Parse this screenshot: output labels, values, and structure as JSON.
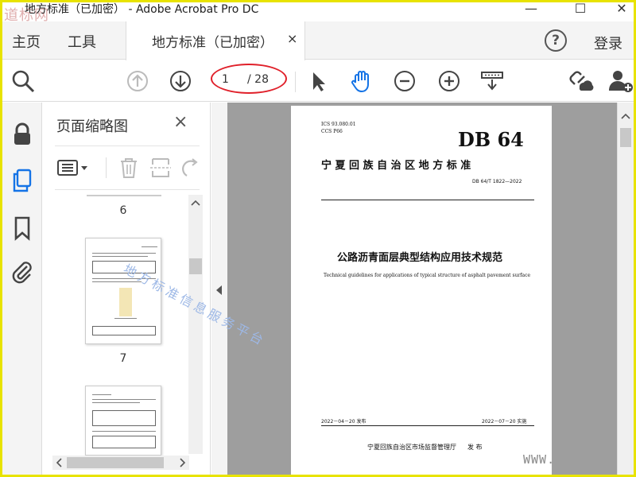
{
  "window": {
    "title": "地方标准（已加密） - Adobe Acrobat Pro DC",
    "watermark_logo": "道标网",
    "minimize": "—",
    "maximize": "☐",
    "close": "✕"
  },
  "menubar": {
    "home": "主页",
    "tools": "工具",
    "tab_label": "地方标准（已加密）",
    "tab_close": "×",
    "help": "?",
    "login": "登录"
  },
  "toolbar": {
    "page_current": "1",
    "page_total": "/ 28",
    "icons": [
      "search-icon",
      "page-up-icon",
      "page-down-icon",
      "select-cursor-icon",
      "hand-icon",
      "zoom-out-icon",
      "zoom-in-icon",
      "scroll-mode-icon",
      "share-link-icon",
      "add-user-icon"
    ]
  },
  "thumbnails_panel": {
    "title": "页面缩略图",
    "close": "×",
    "pages": [
      {
        "label": "6"
      },
      {
        "label": "7"
      }
    ]
  },
  "document_page": {
    "ics": "ICS  93.080.01",
    "ccs": "CCS  P66",
    "db_logo": "DB 64",
    "authority": "宁 夏 回 族 自 治 区 地 方 标 准",
    "number": "DB 64/T  1822—2022",
    "title_cn": "公路沥青面层典型结构应用技术规范",
    "title_en": "Technical guidelines for applications of typical structure of asphalt pavement surface",
    "publish_date": "2022－04－20 发布",
    "implement_date": "2022－07－20 实施",
    "issuer": "宁夏回族自治区市场监督管理厅",
    "issue_word": "发  布",
    "watermark": "地方标准信息服务平台"
  },
  "overlay": {
    "www": "WWW."
  },
  "colors": {
    "accent_blue": "#1473e6",
    "annotation_red": "#e0202a",
    "frame_yellow": "#e8e300"
  }
}
